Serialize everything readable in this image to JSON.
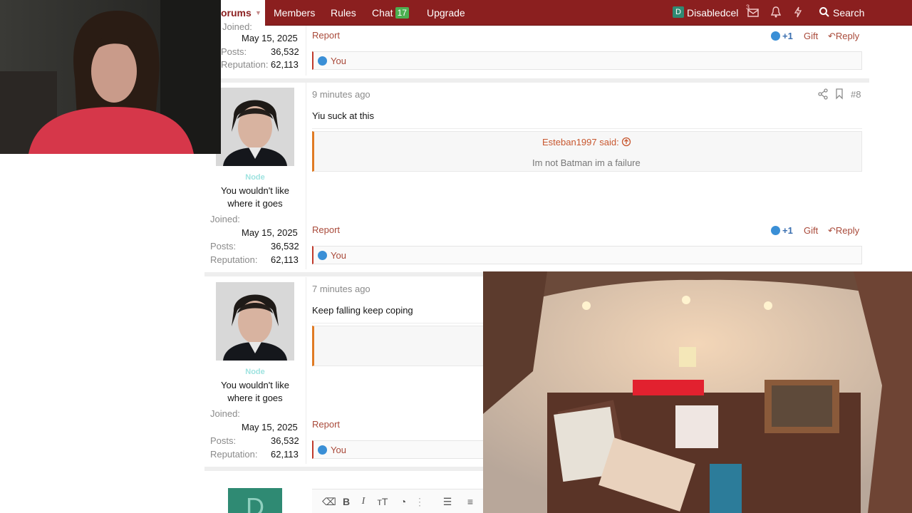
{
  "nav": {
    "forums": "orums",
    "members": "Members",
    "rules": "Rules",
    "chat": "Chat",
    "chat_badge": "17",
    "upgrade": "Upgrade",
    "user_initial": "D",
    "username": "Disabledcel",
    "notif_count": "3",
    "search": "Search",
    "accent": "#8b1f1f"
  },
  "post_prev": {
    "joined_label": "Joined:",
    "joined": "May 15, 2025",
    "posts_label": "Posts:",
    "posts": "36,532",
    "rep_label": "Reputation:",
    "rep": "62,113",
    "report": "Report",
    "plus": "+1",
    "gift": "Gift",
    "reply": "Reply",
    "reaction": "You"
  },
  "post8": {
    "time": "9 minutes ago",
    "num": "#8",
    "body": "Yiu suck at this",
    "quote_author": "Esteban1997 said:",
    "quote_text": "Im not Batman im a failure",
    "role": "Node",
    "user_title": "You wouldn't like where it goes",
    "joined_label": "Joined:",
    "joined": "May 15, 2025",
    "posts_label": "Posts:",
    "posts": "36,532",
    "rep_label": "Reputation:",
    "rep": "62,113",
    "report": "Report",
    "plus": "+1",
    "gift": "Gift",
    "reply": "Reply",
    "reaction": "You"
  },
  "post9": {
    "time": "7 minutes ago",
    "body": "Keep falling keep coping",
    "role": "Node",
    "user_title": "You wouldn't like where it goes",
    "joined_label": "Joined:",
    "joined": "May 15, 2025",
    "posts_label": "Posts:",
    "posts": "36,532",
    "rep_label": "Reputation:",
    "rep": "62,113",
    "report": "Report",
    "reaction": "You"
  },
  "editor": {
    "avatar_initial": "D"
  }
}
